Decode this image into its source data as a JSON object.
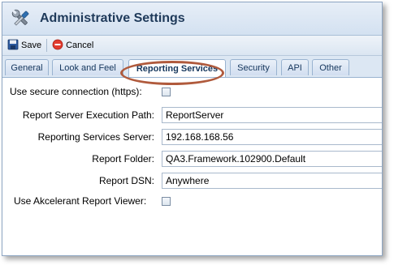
{
  "window": {
    "title": "Administrative Settings",
    "icon": "wrench-screwdriver-icon"
  },
  "toolbar": {
    "save_label": "Save",
    "cancel_label": "Cancel"
  },
  "tabs": [
    {
      "label": "General",
      "active": false
    },
    {
      "label": "Look and Feel",
      "active": false
    },
    {
      "label": "Reporting Services",
      "active": true
    },
    {
      "label": "Security",
      "active": false
    },
    {
      "label": "API",
      "active": false
    },
    {
      "label": "Other",
      "active": false
    }
  ],
  "form": {
    "use_secure_connection": {
      "label": "Use secure connection (https):",
      "checked": false
    },
    "report_server_execution_path": {
      "label": "Report Server Execution Path:",
      "value": "ReportServer"
    },
    "reporting_services_server": {
      "label": "Reporting Services Server:",
      "value": "192.168.168.56"
    },
    "report_folder": {
      "label": "Report Folder:",
      "value": "QA3.Framework.102900.Default"
    },
    "report_dsn": {
      "label": "Report DSN:",
      "value": "Anywhere"
    },
    "use_akcelerant_report_viewer": {
      "label": "Use Akcelerant Report Viewer:",
      "checked": false
    }
  },
  "colors": {
    "highlight_ring": "#b05a3c",
    "title_text": "#1f3a5a"
  }
}
